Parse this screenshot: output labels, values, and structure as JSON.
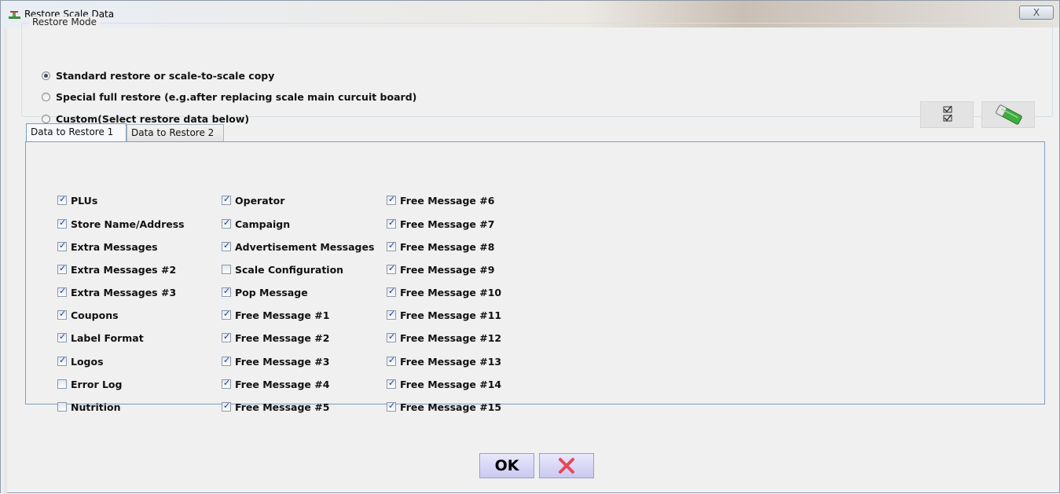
{
  "window": {
    "title": "Restore Scale Data",
    "close_glyph": "X"
  },
  "restore_mode": {
    "label": "Restore Mode",
    "options": [
      {
        "label": "Standard restore or scale-to-scale copy",
        "selected": true
      },
      {
        "label": "Special full restore (e.g.after replacing scale main curcuit board)",
        "selected": false
      },
      {
        "label": "Custom(Select restore data below)",
        "selected": false
      }
    ],
    "tools": [
      {
        "icon": "check-all-icon"
      },
      {
        "icon": "eraser-icon"
      }
    ]
  },
  "tabs": [
    {
      "label": "Data to Restore 1",
      "active": true
    },
    {
      "label": "Data to Restore 2",
      "active": false
    }
  ],
  "columns": [
    [
      {
        "label": "PLUs",
        "checked": true
      },
      {
        "label": "Store Name/Address",
        "checked": true
      },
      {
        "label": "Extra Messages",
        "checked": true
      },
      {
        "label": "Extra Messages #2",
        "checked": true
      },
      {
        "label": "Extra Messages #3",
        "checked": true
      },
      {
        "label": "Coupons",
        "checked": true
      },
      {
        "label": "Label Format",
        "checked": true
      },
      {
        "label": "Logos",
        "checked": true
      },
      {
        "label": "Error Log",
        "checked": false
      },
      {
        "label": "Nutrition",
        "checked": false
      }
    ],
    [
      {
        "label": "Operator",
        "checked": true
      },
      {
        "label": "Campaign",
        "checked": true
      },
      {
        "label": "Advertisement Messages",
        "checked": true
      },
      {
        "label": "Scale Configuration",
        "checked": false
      },
      {
        "label": "Pop Message",
        "checked": true
      },
      {
        "label": "Free Message #1",
        "checked": true
      },
      {
        "label": "Free Message #2",
        "checked": true
      },
      {
        "label": "Free Message #3",
        "checked": true
      },
      {
        "label": "Free Message #4",
        "checked": true
      },
      {
        "label": "Free Message #5",
        "checked": true
      }
    ],
    [
      {
        "label": "Free Message #6",
        "checked": true
      },
      {
        "label": "Free Message #7",
        "checked": true
      },
      {
        "label": "Free Message #8",
        "checked": true
      },
      {
        "label": "Free Message #9",
        "checked": true
      },
      {
        "label": "Free Message #10",
        "checked": true
      },
      {
        "label": "Free Message #11",
        "checked": true
      },
      {
        "label": "Free Message #12",
        "checked": true
      },
      {
        "label": "Free Message #13",
        "checked": true
      },
      {
        "label": "Free Message #14",
        "checked": true
      },
      {
        "label": "Free Message #15",
        "checked": true
      }
    ]
  ],
  "buttons": {
    "ok_label": "OK",
    "cancel_icon": "cancel-x-icon",
    "cancel_color": "#e8485a"
  },
  "colors": {
    "accent": "#7f9db9",
    "check": "#1a3a8e"
  }
}
